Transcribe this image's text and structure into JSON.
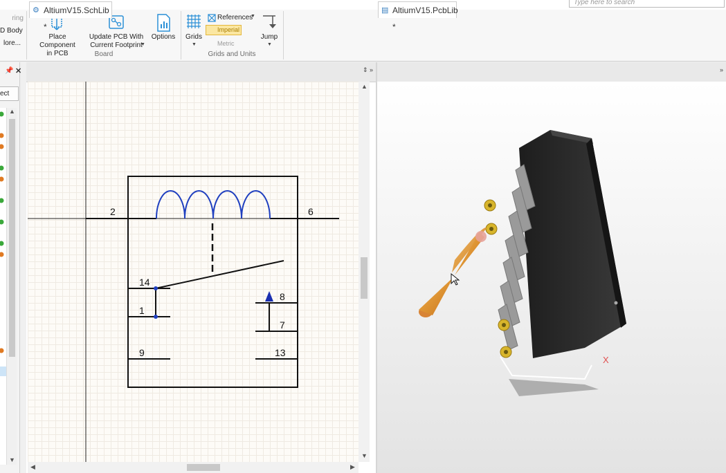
{
  "search": {
    "placeholder": "Type here to search"
  },
  "ribbon": {
    "left_items": [
      "ring",
      "D Body",
      "lore..."
    ],
    "board": {
      "place_component": "Place Component\nin PCB",
      "update_pcb": "Update PCB With\nCurrent Footprint",
      "options": "Options",
      "group_label": "Board"
    },
    "grids_units": {
      "grids": "Grids",
      "references": "References",
      "imperial": "Imperial",
      "metric": "Metric",
      "jump": "Jump",
      "group_label": "Grids and Units"
    }
  },
  "left_panel": {
    "button_label": "ect"
  },
  "sch_tab": {
    "title": "AltiumV15.SchLib *"
  },
  "pcb_tab": {
    "title": "AltiumV15.PcbLib *"
  },
  "schematic": {
    "pins": {
      "p2": "2",
      "p6": "6",
      "p14": "14",
      "p1": "1",
      "p8": "8",
      "p7": "7",
      "p9": "9",
      "p13": "13"
    }
  },
  "pcb3d": {
    "axis_label": "X"
  },
  "icons": [
    "place-component-icon",
    "update-pcb-icon",
    "options-icon",
    "grids-icon",
    "references-icon",
    "jump-icon",
    "pin-icon",
    "close-icon",
    "cursor-icon"
  ],
  "colors": {
    "coil": "#1f3fbf",
    "pin_arrow": "#1a2fb0",
    "body": "#2a2a2a",
    "pads": "#d8b52c",
    "axis_cone": "#e0962a"
  }
}
